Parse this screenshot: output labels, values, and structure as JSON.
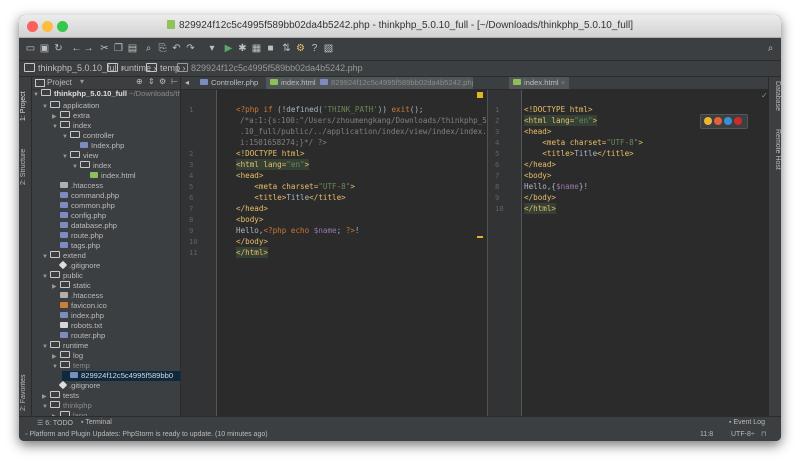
{
  "window": {
    "title": "829924f12c5c4995f589bb02da4b5242.php - thinkphp_5.0.10_full - [~/Downloads/thinkphp_5.0.10_full]",
    "traffic_lights": [
      "#fc605c",
      "#fdbc40",
      "#34c84a"
    ]
  },
  "breadcrumb": {
    "items": [
      "thinkphp_5.0.10_full",
      "runtime",
      "temp",
      "829924f12c5c4995f589bb02da4b5242.php"
    ]
  },
  "left_tabs": [
    "1: Project",
    "2: Structure",
    "2: Favorites"
  ],
  "right_tabs": [
    "Database",
    "Remote Host"
  ],
  "project": {
    "header_label": "Project",
    "root_name": "thinkphp_5.0.10_full",
    "root_path": "~/Downloads/th",
    "items": [
      {
        "label": "application",
        "kind": "folder",
        "arrow": "open"
      },
      {
        "label": "extra",
        "kind": "folder",
        "arrow": "closed"
      },
      {
        "label": "index",
        "kind": "folder",
        "arrow": "open"
      },
      {
        "label": "controller",
        "kind": "folder",
        "arrow": "open"
      },
      {
        "label": "Index.php",
        "kind": "php",
        "arrow": ""
      },
      {
        "label": "view",
        "kind": "folder",
        "arrow": "open"
      },
      {
        "label": "index",
        "kind": "folder",
        "arrow": "open"
      },
      {
        "label": "index.html",
        "kind": "html",
        "arrow": ""
      },
      {
        "label": ".htaccess",
        "kind": "ht",
        "arrow": ""
      },
      {
        "label": "command.php",
        "kind": "php",
        "arrow": ""
      },
      {
        "label": "common.php",
        "kind": "php",
        "arrow": ""
      },
      {
        "label": "config.php",
        "kind": "php",
        "arrow": ""
      },
      {
        "label": "database.php",
        "kind": "php",
        "arrow": ""
      },
      {
        "label": "route.php",
        "kind": "php",
        "arrow": ""
      },
      {
        "label": "tags.php",
        "kind": "php",
        "arrow": ""
      },
      {
        "label": "extend",
        "kind": "folder",
        "arrow": "open"
      },
      {
        "label": ".gitignore",
        "kind": "git",
        "arrow": ""
      },
      {
        "label": "public",
        "kind": "folder",
        "arrow": "open"
      },
      {
        "label": "static",
        "kind": "folder",
        "arrow": "closed"
      },
      {
        "label": ".htaccess",
        "kind": "ht",
        "arrow": ""
      },
      {
        "label": "favicon.ico",
        "kind": "ico",
        "arrow": ""
      },
      {
        "label": "index.php",
        "kind": "php",
        "arrow": ""
      },
      {
        "label": "robots.txt",
        "kind": "txt",
        "arrow": ""
      },
      {
        "label": "router.php",
        "kind": "php",
        "arrow": ""
      },
      {
        "label": "runtime",
        "kind": "folder",
        "arrow": "open"
      },
      {
        "label": "log",
        "kind": "folder",
        "arrow": "closed"
      },
      {
        "label": "temp",
        "kind": "folder",
        "arrow": "open"
      },
      {
        "label": "829924f12c5c4995f589bb0",
        "kind": "php",
        "arrow": ""
      },
      {
        "label": ".gitignore",
        "kind": "git",
        "arrow": ""
      },
      {
        "label": "tests",
        "kind": "folder",
        "arrow": "closed"
      },
      {
        "label": "thinkphp",
        "kind": "folder",
        "arrow": "open"
      },
      {
        "label": "lang",
        "kind": "folder",
        "arrow": "closed"
      },
      {
        "label": "library",
        "kind": "folder",
        "arrow": "open"
      }
    ]
  },
  "editor_tabs": [
    {
      "label": "Controller.php"
    },
    {
      "label": "index.html"
    },
    {
      "label": "829924f12c5c4995f589bb02da4b5242.php"
    },
    {
      "label": "index.html"
    }
  ],
  "left_editor": {
    "line_numbers": [
      "1",
      "2",
      "3",
      "4",
      "5",
      "6",
      "7",
      "8",
      "9",
      "10",
      "11"
    ],
    "lines": [
      "<?php if (!defined('THINK_PATH')) exit();",
      "/*a:1:{s:100:\"/Users/zhoumengkang/Downloads/thinkphp_5.0",
      ".10_full/public/../application/index/view/index/index.html\";",
      "i:1501658274;}*/ ?>",
      "<!DOCTYPE html>",
      "<html lang=\"en\">",
      "<head>",
      "    <meta charset=\"UTF-8\">",
      "    <title>Title</title>",
      "</head>",
      "<body>",
      "Hello,<?php echo $name; ?>!",
      "</body>",
      "</html>"
    ]
  },
  "right_editor": {
    "line_numbers": [
      "1",
      "2",
      "3",
      "4",
      "5",
      "6",
      "7",
      "8",
      "9",
      "10"
    ],
    "lines": [
      "<!DOCTYPE html>",
      "<html lang=\"en\">",
      "<head>",
      "    <meta charset=\"UTF-8\">",
      "    <title>Title</title>",
      "</head>",
      "<body>",
      "Hello,{$name}!",
      "</body>",
      "</html>"
    ],
    "browser_icons": [
      "chrome-icon",
      "firefox-icon",
      "safari-icon",
      "opera-icon"
    ]
  },
  "statusbar": {
    "todo": "6: TODO",
    "terminal": "Terminal",
    "event_log": "Event Log",
    "message": "Platform and Plugin Updates: PhpStorm is ready to update. (10 minutes ago)",
    "position": "11:8",
    "encoding": "UTF-8÷"
  }
}
